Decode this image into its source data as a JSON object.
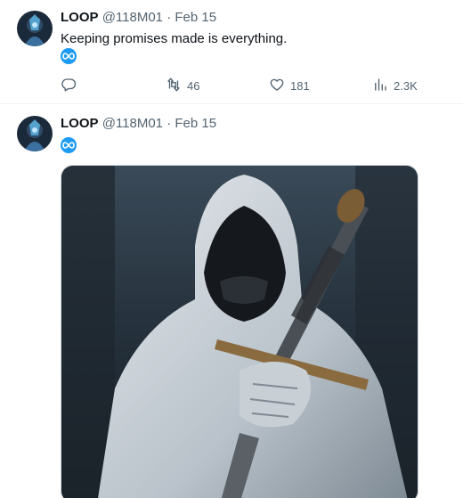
{
  "tweets": [
    {
      "name": "LOOP",
      "handle": "@118M01",
      "separator": "·",
      "date": "Feb 15",
      "text": "Keeping promises made is everything.",
      "badge_icon": "infinity-icon",
      "actions": {
        "reply_icon": "reply-icon",
        "retweets": "46",
        "likes": "181",
        "views": "2.3K"
      }
    },
    {
      "name": "LOOP",
      "handle": "@118M01",
      "separator": "·",
      "date": "Feb 15",
      "badge_icon": "infinity-icon"
    }
  ],
  "colors": {
    "accent": "#1d9bf0",
    "secondary_text": "#536471",
    "divider": "#eff3f4"
  }
}
